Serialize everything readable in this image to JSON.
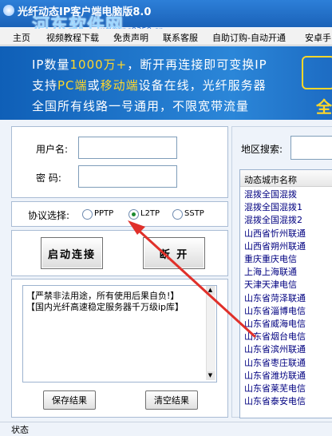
{
  "window": {
    "title": "光纤动态IP客户端电脑版8.0",
    "watermark": "河东软件网",
    "watermark_url": "www.pc0359.cn"
  },
  "menu": [
    "主页",
    "视频教程下载",
    "免责声明",
    "联系客服",
    "自助订购-自动开通",
    "安卓手"
  ],
  "banner": {
    "line1_a": "IP数量",
    "line1_hl": "1000万+",
    "line1_b": "，断开再连接即可变换IP",
    "line2_a": "支持",
    "line2_hl1": "PC端",
    "line2_mid": "或",
    "line2_hl2": "移动端",
    "line2_b": "设备在线，光纤服务器",
    "line3": "全国所有线路一号通用，不限宽带流量",
    "right_char": "全"
  },
  "login": {
    "username_label": "用户名:",
    "password_label": "密  码:",
    "username_value": "",
    "password_value": ""
  },
  "protocol": {
    "label": "协议选择:",
    "options": [
      "PPTP",
      "L2TP",
      "SSTP"
    ],
    "selected": "L2TP"
  },
  "buttons": {
    "connect": "启动连接",
    "disconnect": "断 开",
    "save": "保存结果",
    "clear": "清空结果"
  },
  "log": [
    "【严禁非法用途，所有使用后果自负!】",
    "【国内光纤高速稳定服务器千万级ip库】"
  ],
  "region": {
    "label": "地区搜索:",
    "value": ""
  },
  "city_list": {
    "header": "动态城市名称",
    "rows": [
      "混拨全国混拨",
      "混拨全国混拨1",
      "混拨全国混拨2",
      "山西省忻州联通",
      "山西省朔州联通",
      "重庆重庆电信",
      "上海上海联通",
      "天津天津电信",
      "山东省菏泽联通",
      "山东省淄博电信",
      "山东省威海电信",
      "山东省烟台电信",
      "山东省滨州联通",
      "山东省枣庄联通",
      "山东省潍坊联通",
      "山东省莱芜电信",
      "山东省泰安电信"
    ]
  },
  "status": {
    "text": "状态"
  },
  "colors": {
    "title_bar": "#1a62b8",
    "banner_highlight": "#ffd72a",
    "arrow": "#e0302a",
    "city_text": "#000080"
  }
}
